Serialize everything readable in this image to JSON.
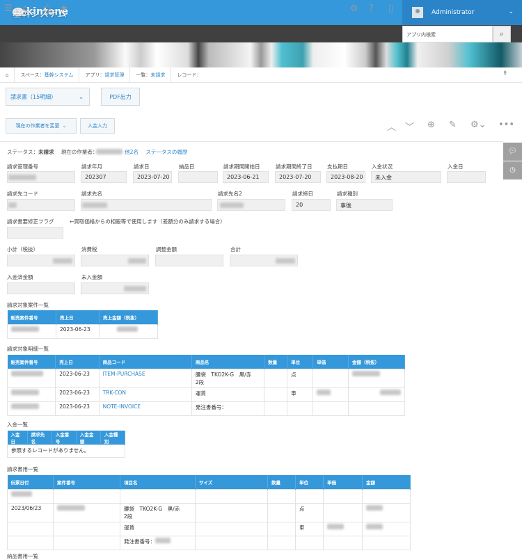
{
  "header": {
    "logo": "kintone",
    "user": "Administrator",
    "search_placeholder": "アプリ内検索"
  },
  "banner": {
    "title": "基幹システム"
  },
  "breadcrumb": {
    "space_label": "スペース：",
    "space": "基幹システム",
    "app_label": "アプリ：",
    "app": "請求管理",
    "list_label": "一覧：",
    "list": "未請求",
    "record_label": "レコード："
  },
  "toolbar": {
    "template": "請求書（15明細）",
    "pdf": "PDF出力",
    "change_assignee": "現在の作業者を変更",
    "payment_entry": "入金入力"
  },
  "status": {
    "label": "ステータス：",
    "value": "未請求",
    "assignee_label": "現在の作業者：",
    "others": "他2名",
    "history": "ステータスの履歴"
  },
  "fields": {
    "billing_no": "請求管理番号",
    "billing_month": "請求年月",
    "billing_month_v": "202307",
    "billing_date": "請求日",
    "billing_date_v": "2023-07-20",
    "delivery_date": "納品日",
    "period_start": "請求期間開始日",
    "period_start_v": "2023-06-21",
    "period_end": "請求期間終了日",
    "period_end_v": "2023-07-20",
    "pay_due": "支払期日",
    "pay_due_v": "2023-08-20",
    "payment_status": "入金状況",
    "payment_status_v": "未入金",
    "payment_date": "入金日",
    "client_code": "請求先コード",
    "client_name": "請求先名",
    "client_name2": "請求先名2",
    "closing_day": "請求締日",
    "closing_day_v": "20",
    "billing_type": "請求種別",
    "billing_type_v": "事後",
    "flag": "請求書要修正フラグ",
    "flag_note": "←買取価格からの相殺等で使用します（差額分のみ請求する場合）",
    "subtotal": "小計（税抜）",
    "tax": "消費税",
    "adjust": "調整金額",
    "total": "合計",
    "paid": "入金済金額",
    "unpaid": "未入金額"
  },
  "table1": {
    "title": "請求対象案件一覧",
    "headers": [
      "販売案件番号",
      "売上日",
      "売上金額（税抜）"
    ],
    "rows": [
      {
        "date": "2023-06-23"
      }
    ]
  },
  "table2": {
    "title": "請求対象明細一覧",
    "headers": [
      "販売案件番号",
      "売上日",
      "商品コード",
      "商品名",
      "数量",
      "単位",
      "単価",
      "金額（税抜）"
    ],
    "rows": [
      {
        "date": "2023-06-23",
        "code": "ITEM-PURCHASE",
        "name1": "腰袋　TKO2K-G　黒/赤",
        "name2": "2段",
        "unit": "点"
      },
      {
        "date": "2023-06-23",
        "code": "TRK-CON",
        "name1": "運賃",
        "unit": "車"
      },
      {
        "date": "2023-06-23",
        "code": "NOTE-INVOICE",
        "name1": "発注書番号："
      }
    ]
  },
  "table3": {
    "title": "入金一覧",
    "headers": [
      "入金日",
      "請求先名",
      "入金番号",
      "入金金額",
      "入金種別"
    ],
    "empty": "参照するレコードがありません。"
  },
  "table4": {
    "title": "請求書用一覧",
    "headers": [
      "伝票日付",
      "案件番号",
      "項目名",
      "サイズ",
      "数量",
      "単位",
      "単価",
      "金額"
    ],
    "rows": [
      {
        "date": "2023/06/23",
        "name1": "腰袋　TKO2K-G　黒/赤",
        "name2": "2段",
        "unit": "点"
      },
      {
        "name1": "運賃",
        "unit": "車"
      },
      {
        "name1": "発注書番号："
      }
    ]
  },
  "table5": {
    "title": "納品書用一覧"
  }
}
